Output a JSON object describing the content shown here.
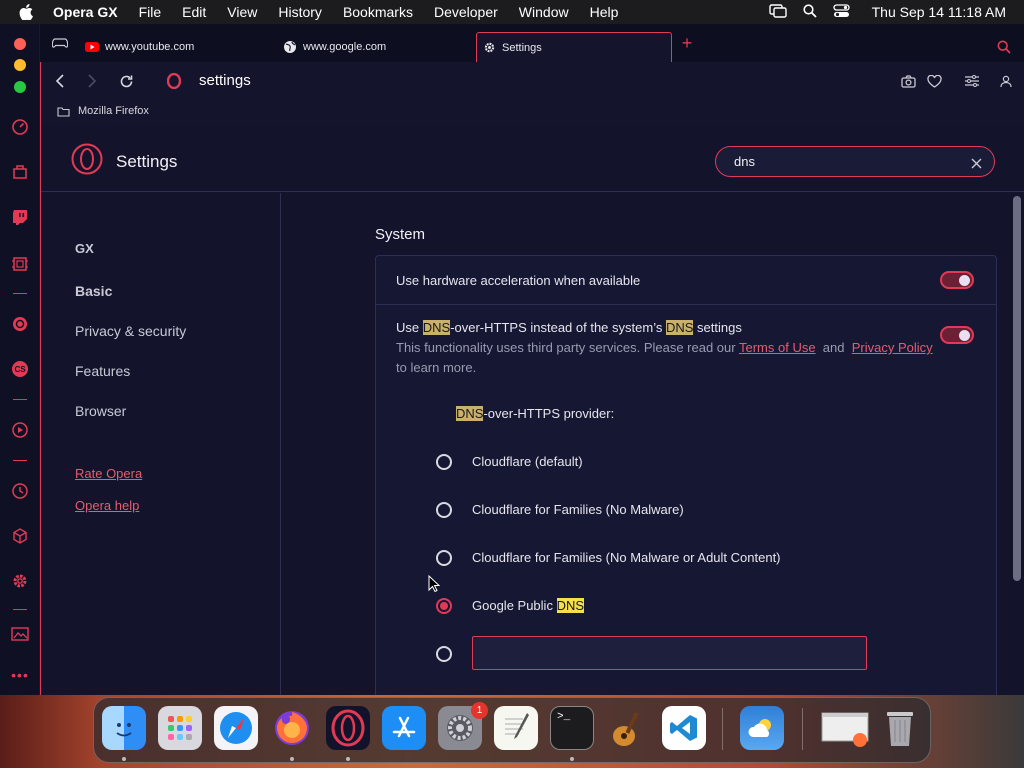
{
  "menubar": {
    "app_name": "Opera GX",
    "menus": [
      "File",
      "Edit",
      "View",
      "History",
      "Bookmarks",
      "Developer",
      "Window",
      "Help"
    ],
    "clock": "Thu Sep 14  11:18 AM"
  },
  "tabs": [
    {
      "label": "www.youtube.com",
      "icon": "youtube-icon"
    },
    {
      "label": "www.google.com",
      "icon": "globe-icon"
    },
    {
      "label": "Settings",
      "icon": "gear-icon",
      "active": true
    }
  ],
  "toolbar": {
    "address": "settings"
  },
  "bookmarks": {
    "items": [
      "Mozilla Firefox"
    ]
  },
  "settings": {
    "title": "Settings",
    "search_value": "dns",
    "nav": [
      "GX",
      "Basic",
      "Privacy & security",
      "Features",
      "Browser"
    ],
    "links": [
      "Rate Opera",
      "Opera help"
    ],
    "section": "System",
    "hardware_accel": {
      "label": "Use hardware acceleration when available",
      "enabled": true
    },
    "doh": {
      "label_pre": "Use ",
      "label_hl1": "DNS",
      "label_mid": "-over-HTTPS instead of the system’s ",
      "label_hl2": "DNS",
      "label_post": " settings",
      "desc_pre": "This functionality uses third party services. Please read our ",
      "terms": "Terms of Use",
      "and": "and",
      "privacy": "Privacy Policy",
      "desc_post": "to learn more.",
      "enabled": true
    },
    "provider": {
      "label_hl": "DNS",
      "label_post": "-over-HTTPS provider:"
    },
    "options": [
      {
        "label": "Cloudflare (default)",
        "selected": false
      },
      {
        "label": "Cloudflare for Families (No Malware)",
        "selected": false
      },
      {
        "label": "Cloudflare for Families (No Malware or Adult Content)",
        "selected": false
      },
      {
        "label_pre": "Google Public ",
        "label_hl": "DNS",
        "selected": true
      },
      {
        "label": "",
        "selected": false,
        "custom": true
      }
    ]
  },
  "dock": {
    "apps": [
      "Finder",
      "Launchpad",
      "Safari",
      "Firefox",
      "Opera GX",
      "App Store",
      "System Settings",
      "TextEdit",
      "Terminal",
      "Instruments",
      "Visual Studio Code",
      "Weather",
      "Preview",
      "Trash"
    ],
    "settings_badge": "1"
  },
  "colors": {
    "accent": "#e23a55",
    "highlight": "#c9b16c",
    "highlight_active": "#f6e04a",
    "background": "#13142c"
  }
}
